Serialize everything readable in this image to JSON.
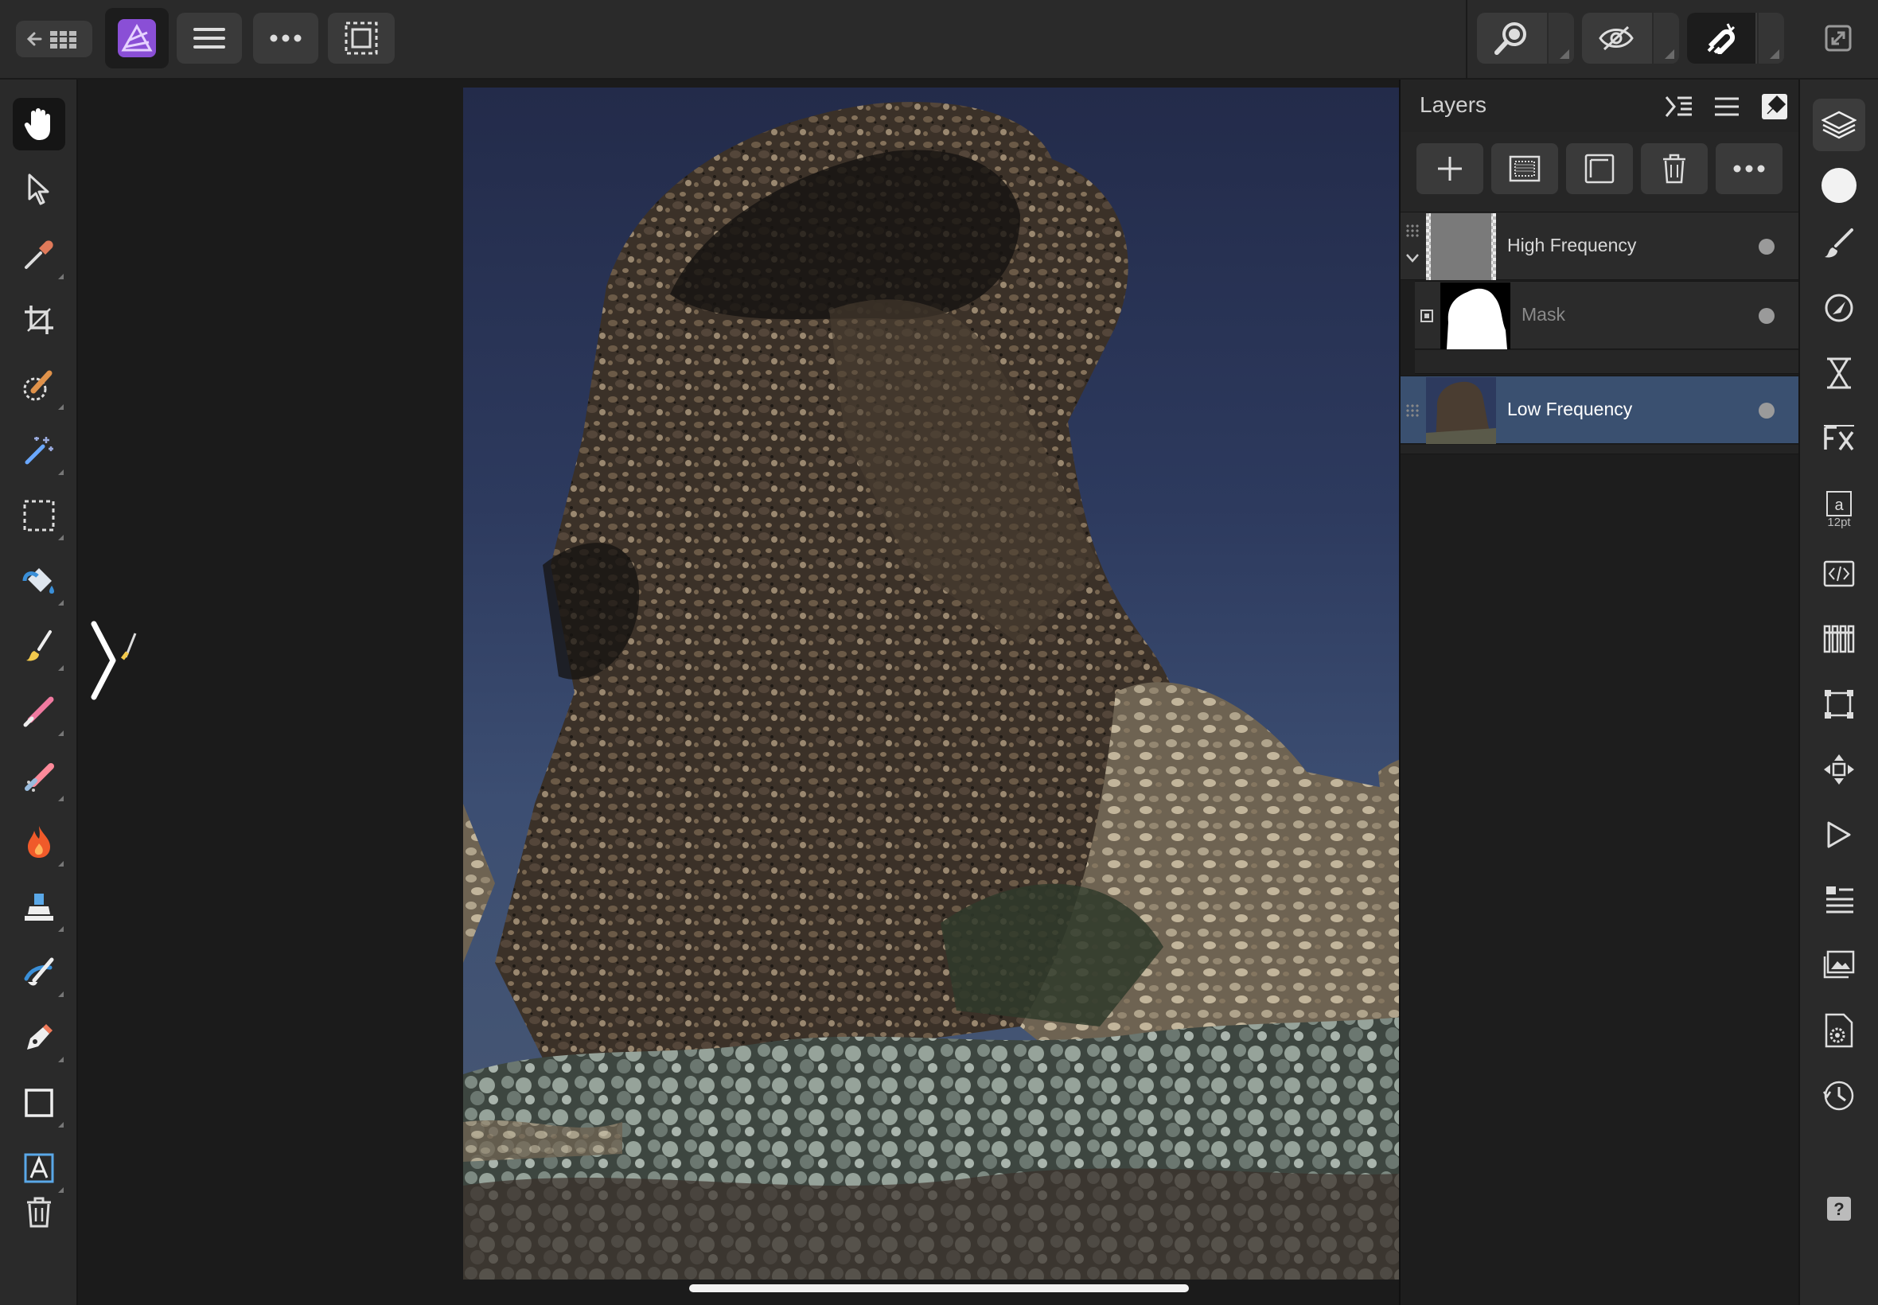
{
  "topbar": {
    "left_buttons": [
      "back-gallery",
      "affinity-photo-logo",
      "menu",
      "more",
      "selection"
    ],
    "right_segments": [
      {
        "name": "zoom",
        "active": false
      },
      {
        "name": "view-mode",
        "active": false
      },
      {
        "name": "snapping",
        "active": true
      }
    ]
  },
  "tools": [
    {
      "name": "hand-tool",
      "active": true
    },
    {
      "name": "move-tool"
    },
    {
      "name": "color-picker-tool"
    },
    {
      "name": "crop-tool"
    },
    {
      "name": "selection-brush-tool"
    },
    {
      "name": "magic-wand-tool"
    },
    {
      "name": "marquee-tool"
    },
    {
      "name": "flood-fill-tool"
    },
    {
      "name": "paint-brush-tool"
    },
    {
      "name": "erase-brush-tool"
    },
    {
      "name": "dodge-burn-tool"
    },
    {
      "name": "clone-stamp-tool"
    },
    {
      "name": "smudge-tool"
    },
    {
      "name": "pen-tool"
    },
    {
      "name": "rectangle-tool"
    },
    {
      "name": "artistic-text-tool"
    },
    {
      "name": "trash"
    }
  ],
  "layers_panel": {
    "title": "Layers",
    "layers": [
      {
        "name": "High Frequency",
        "selected": false,
        "expanded": true,
        "visible": true
      },
      {
        "name": "Mask",
        "selected": false,
        "child": true,
        "visible": true
      },
      {
        "name": "Low Frequency",
        "selected": true,
        "visible": true
      }
    ]
  },
  "studio": {
    "text_size_label": "12pt",
    "icons": [
      "layers",
      "color",
      "brushes",
      "adjustments",
      "filters",
      "fx",
      "text-style",
      "source-code",
      "channels",
      "transform",
      "navigator",
      "macro",
      "history-list",
      "stock",
      "document-settings",
      "history",
      "help"
    ]
  },
  "colors": {
    "accent_selected_layer": "#3a5070",
    "logo_purple": "#8a4fd6"
  }
}
